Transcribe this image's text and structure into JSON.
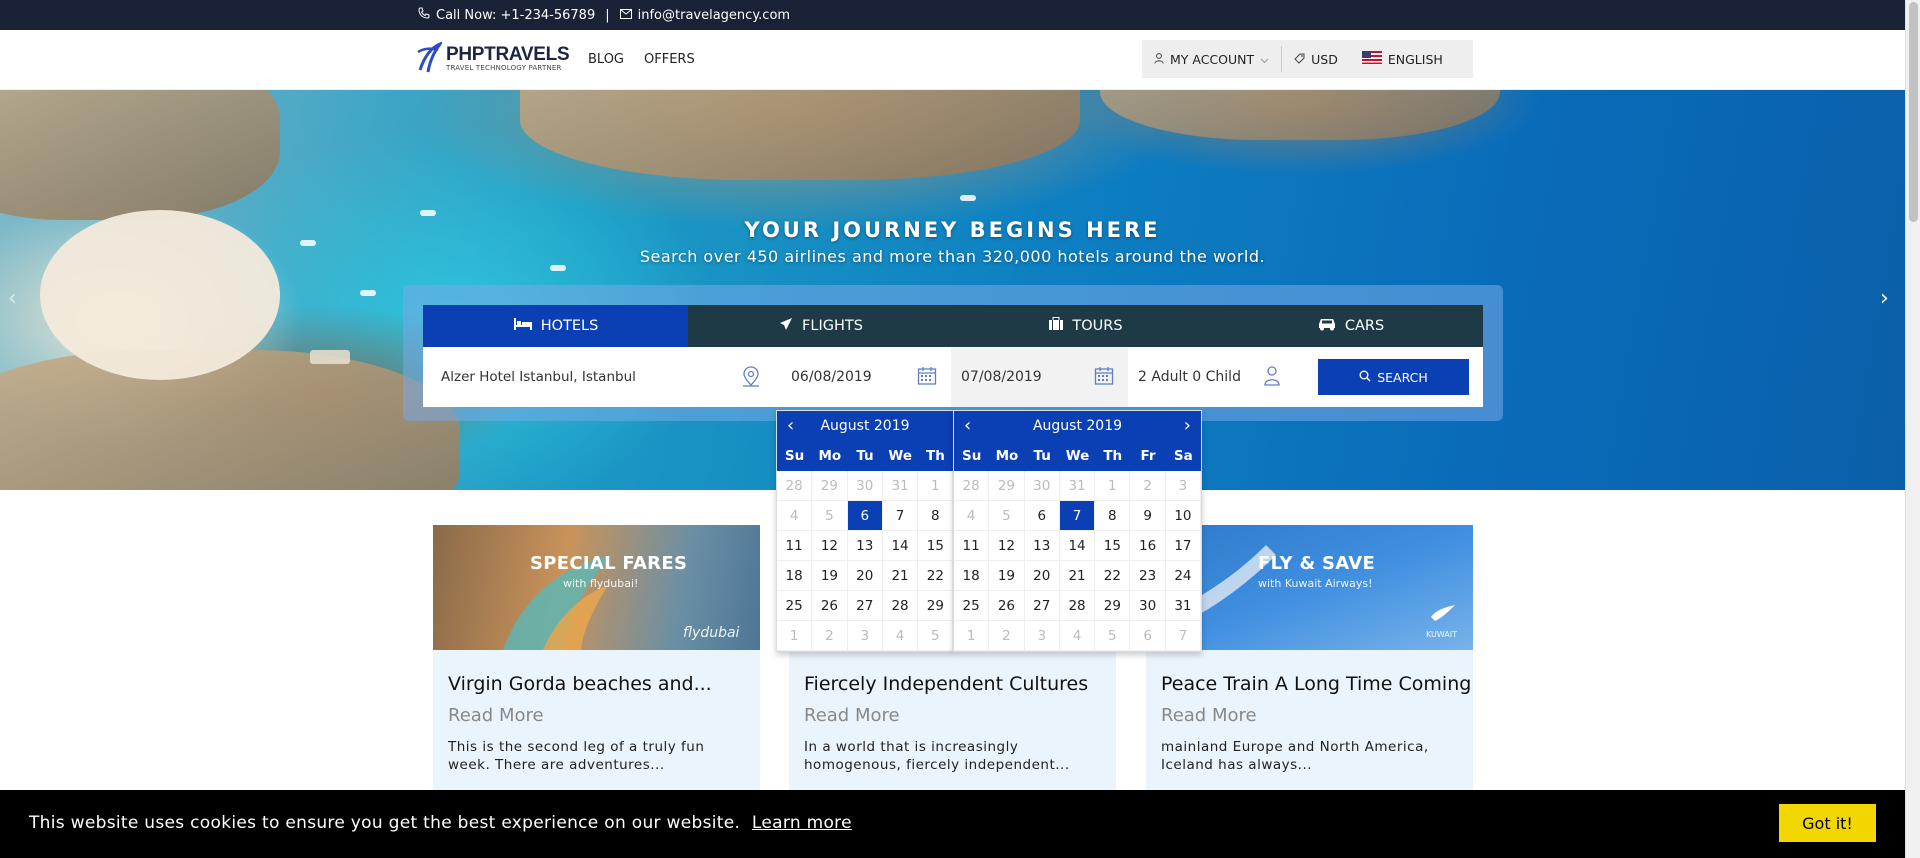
{
  "topbar": {
    "phone": "Call Now: +1-234-56789",
    "separator": "|",
    "email": "info@travelagency.com"
  },
  "header": {
    "brand": "PHPTRAVELS",
    "tagline": "TRAVEL TECHNOLOGY PARTNER",
    "nav": [
      "BLOG",
      "OFFERS"
    ],
    "account": "MY ACCOUNT",
    "currency": "USD",
    "language": "ENGLISH"
  },
  "hero": {
    "title": "YOUR JOURNEY BEGINS HERE",
    "subtitle": "Search over 450 airlines and more than 320,000 hotels around the world."
  },
  "search": {
    "tabs": [
      "HOTELS",
      "FLIGHTS",
      "TOURS",
      "CARS"
    ],
    "active_tab": "HOTELS",
    "hotel": "Alzer Hotel Istanbul, Istanbul",
    "checkin": "06/08/2019",
    "checkout": "07/08/2019",
    "guests": "2 Adult 0 Child",
    "button": "SEARCH"
  },
  "datepickers": [
    {
      "month": "August 2019",
      "dow": [
        "Su",
        "Mo",
        "Tu",
        "We",
        "Th"
      ],
      "rows": [
        [
          [
            "28",
            "m"
          ],
          [
            "29",
            "m"
          ],
          [
            "30",
            "m"
          ],
          [
            "31",
            "m"
          ],
          [
            "1",
            "m"
          ]
        ],
        [
          [
            "4",
            "m"
          ],
          [
            "5",
            "m"
          ],
          [
            "6",
            "s"
          ],
          [
            "7",
            ""
          ],
          [
            "8",
            ""
          ]
        ],
        [
          [
            "11",
            ""
          ],
          [
            "12",
            ""
          ],
          [
            "13",
            ""
          ],
          [
            "14",
            ""
          ],
          [
            "15",
            ""
          ]
        ],
        [
          [
            "18",
            ""
          ],
          [
            "19",
            ""
          ],
          [
            "20",
            ""
          ],
          [
            "21",
            ""
          ],
          [
            "22",
            ""
          ]
        ],
        [
          [
            "25",
            ""
          ],
          [
            "26",
            ""
          ],
          [
            "27",
            ""
          ],
          [
            "28",
            ""
          ],
          [
            "29",
            ""
          ]
        ],
        [
          [
            "1",
            "m"
          ],
          [
            "2",
            "m"
          ],
          [
            "3",
            "m"
          ],
          [
            "4",
            "m"
          ],
          [
            "5",
            "m"
          ]
        ]
      ]
    },
    {
      "month": "August 2019",
      "dow": [
        "Su",
        "Mo",
        "Tu",
        "We",
        "Th",
        "Fr",
        "Sa"
      ],
      "rows": [
        [
          [
            "28",
            "m"
          ],
          [
            "29",
            "m"
          ],
          [
            "30",
            "m"
          ],
          [
            "31",
            "m"
          ],
          [
            "1",
            "m"
          ],
          [
            "2",
            "m"
          ],
          [
            "3",
            "m"
          ]
        ],
        [
          [
            "4",
            "m"
          ],
          [
            "5",
            "m"
          ],
          [
            "6",
            ""
          ],
          [
            "7",
            "s"
          ],
          [
            "8",
            ""
          ],
          [
            "9",
            ""
          ],
          [
            "10",
            ""
          ]
        ],
        [
          [
            "11",
            ""
          ],
          [
            "12",
            ""
          ],
          [
            "13",
            ""
          ],
          [
            "14",
            ""
          ],
          [
            "15",
            ""
          ],
          [
            "16",
            ""
          ],
          [
            "17",
            ""
          ]
        ],
        [
          [
            "18",
            ""
          ],
          [
            "19",
            ""
          ],
          [
            "20",
            ""
          ],
          [
            "21",
            ""
          ],
          [
            "22",
            ""
          ],
          [
            "23",
            ""
          ],
          [
            "24",
            ""
          ]
        ],
        [
          [
            "25",
            ""
          ],
          [
            "26",
            ""
          ],
          [
            "27",
            ""
          ],
          [
            "28",
            ""
          ],
          [
            "29",
            ""
          ],
          [
            "30",
            ""
          ],
          [
            "31",
            ""
          ]
        ],
        [
          [
            "1",
            "m"
          ],
          [
            "2",
            "m"
          ],
          [
            "3",
            "m"
          ],
          [
            "4",
            "m"
          ],
          [
            "5",
            "m"
          ],
          [
            "6",
            "m"
          ],
          [
            "7",
            "m"
          ]
        ]
      ]
    }
  ],
  "cards": [
    {
      "banner_title": "SPECIAL FARES",
      "banner_sub": "with flydubai!",
      "banner_brand": "flydubai",
      "title": "Virgin Gorda beaches and...",
      "read_more": "Read More",
      "desc": "This is the second leg of a truly fun week. There are adventures..."
    },
    {
      "title": "Fiercely Independent Cultures",
      "read_more": "Read More",
      "desc": "In a world that is increasingly homogenous, fiercely independent..."
    },
    {
      "banner_title": "FLY & SAVE",
      "banner_sub": "with Kuwait Airways!",
      "banner_brand": "KUWAIT",
      "title": "Peace Train A Long Time Coming",
      "read_more": "Read More",
      "desc": " mainland Europe and North America, Iceland has always..."
    }
  ],
  "cookie": {
    "message": "This website uses cookies to ensure you get the best experience on our website.",
    "learn": "Learn more",
    "button": "Got it!"
  },
  "colors": {
    "primary": "#0b3fb4",
    "topbar": "#1a2238",
    "tabbar": "#1e3a46",
    "cookie_btn": "#f1d600"
  }
}
